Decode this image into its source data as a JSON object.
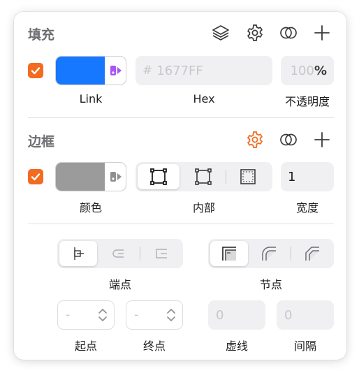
{
  "fill": {
    "title": "填充",
    "enabled": true,
    "color": "#1677FF",
    "color_label": "Link",
    "hex_prefix": "#",
    "hex_value": "1677FF",
    "hex_label": "Hex",
    "opacity_value": "100",
    "opacity_unit": "%",
    "opacity_label": "不透明度",
    "header_icons": [
      "layers-icon",
      "gear-icon",
      "overlap-circles-icon",
      "plus-icon"
    ],
    "token_color": "#a855f7"
  },
  "border": {
    "title": "边框",
    "enabled": true,
    "color": "#9b9b9b",
    "color_label": "颜色",
    "position_label": "内部",
    "position_options": [
      "inside-border-icon",
      "center-border-icon",
      "outside-border-icon"
    ],
    "position_selected": 0,
    "width_value": "1",
    "width_label": "宽度",
    "header_icons": [
      "gear-icon",
      "overlap-circles-icon",
      "plus-icon"
    ],
    "gear_color": "#f26b21"
  },
  "stroke": {
    "cap_label": "端点",
    "cap_options": [
      "cap-butt-icon",
      "cap-round-icon",
      "cap-square-icon"
    ],
    "cap_selected": 0,
    "join_label": "节点",
    "join_options": [
      "join-miter-icon",
      "join-round-icon",
      "join-bevel-icon"
    ],
    "join_selected": 0,
    "start_value": "-",
    "start_label": "起点",
    "end_value": "-",
    "end_label": "终点",
    "dash_value": "0",
    "dash_label": "虚线",
    "gap_value": "0",
    "gap_label": "间隔"
  },
  "colors": {
    "accent": "#f26b21",
    "divider": "#e3e3e6",
    "field_bg": "#f0f0f2",
    "muted_text": "#c7c7cc"
  }
}
